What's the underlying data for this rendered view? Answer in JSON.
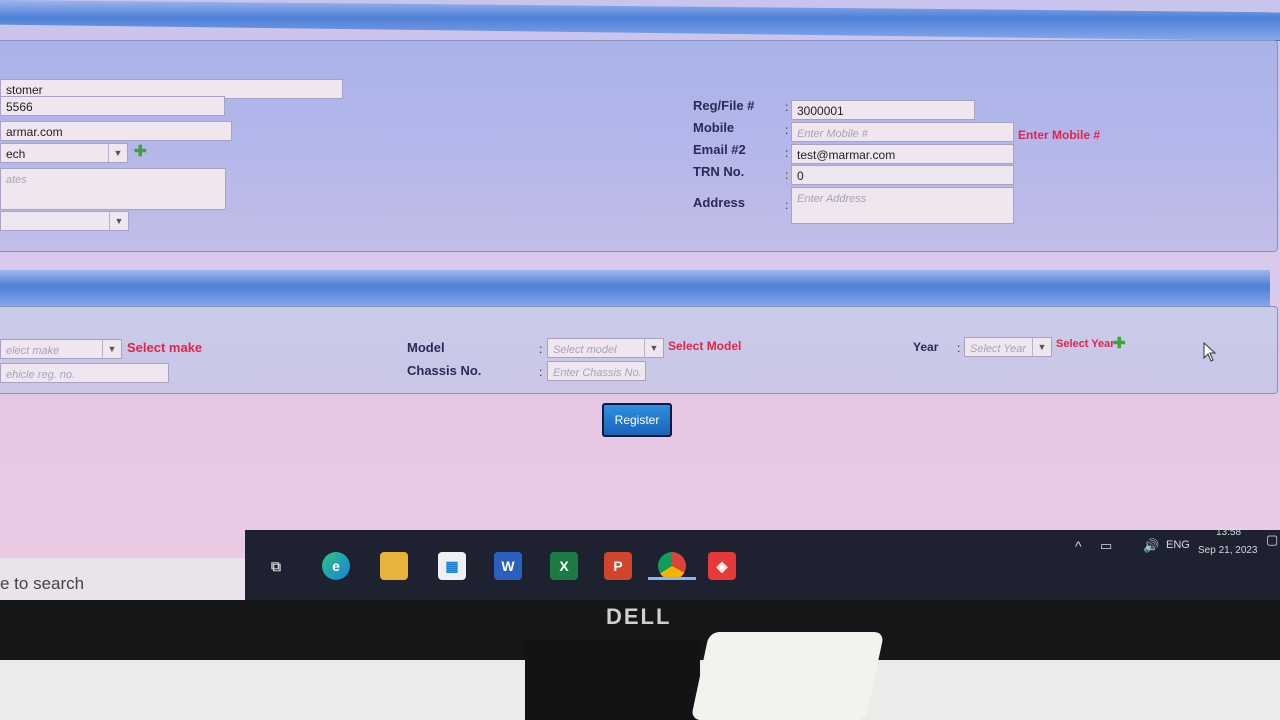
{
  "customer": {
    "type_value": "stomer",
    "phone_value": "5566",
    "email_value": "armar.com",
    "salesperson_value": "ech",
    "notes_placeholder": "ates"
  },
  "reg_section": {
    "reg_file_label": "Reg/File #",
    "reg_file_value": "3000001",
    "mobile_label": "Mobile",
    "mobile_placeholder": "Enter Mobile #",
    "mobile_error": "Enter Mobile #",
    "email2_label": "Email #2",
    "email2_value": "test@marmar.com",
    "trn_label": "TRN No.",
    "trn_value": "0",
    "address_label": "Address",
    "address_placeholder": "Enter Address"
  },
  "vehicle": {
    "make_placeholder": "elect make",
    "make_error": "Select make",
    "reg_no_placeholder": "ehicle reg. no.",
    "model_label": "Model",
    "model_placeholder": "Select model",
    "model_error": "Select Model",
    "chassis_label": "Chassis No.",
    "chassis_placeholder": "Enter Chassis No.",
    "year_label": "Year",
    "year_placeholder": "Select Year",
    "year_error": "Select Year"
  },
  "register_label": "Register",
  "taskbar": {
    "search_text": "e to search",
    "apps": [
      "task-view",
      "edge",
      "file-explorer",
      "store",
      "word",
      "excel",
      "powerpoint",
      "chrome",
      "anydesk"
    ],
    "language": "ENG",
    "time": "13:58",
    "date": "Sep 21, 2023"
  },
  "monitor_brand": "DELL",
  "colors": {
    "error": "#e0244c",
    "button": "#1a63b8",
    "taskbar": "#1e2230"
  }
}
